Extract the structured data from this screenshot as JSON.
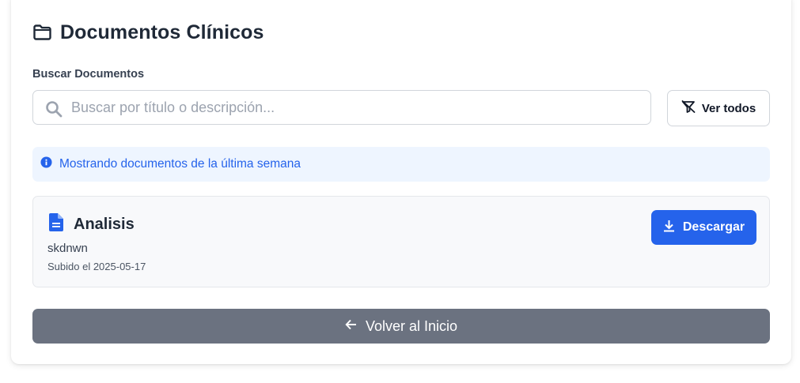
{
  "header": {
    "icon": "folder-icon",
    "title": "Documentos Clínicos"
  },
  "search": {
    "label": "Buscar Documentos",
    "placeholder": "Buscar por título o descripción...",
    "value": "",
    "icon": "search-icon"
  },
  "filter": {
    "view_all_label": "Ver todos",
    "icon": "filter-off-icon"
  },
  "alert": {
    "icon": "info-icon",
    "text": "Mostrando documentos de la última semana"
  },
  "documents": [
    {
      "icon": "document-icon",
      "title": "Analisis",
      "description": "skdnwn",
      "uploaded": "Subido el 2025-05-17",
      "download_label": "Descargar",
      "download_icon": "download-icon"
    }
  ],
  "footer": {
    "back_label": "Volver al Inicio",
    "back_icon": "arrow-left-icon"
  },
  "colors": {
    "primary": "#2563eb",
    "secondary": "#6b7280",
    "alert_bg": "#eef5ff",
    "text_dark": "#1f2937"
  }
}
